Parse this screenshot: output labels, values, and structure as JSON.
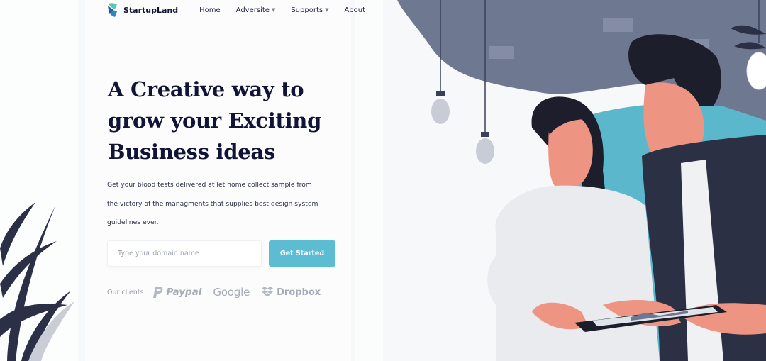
{
  "brand": {
    "name": "StartupLand"
  },
  "nav": [
    {
      "label": "Home",
      "dropdown": false
    },
    {
      "label": "Adversite",
      "dropdown": true
    },
    {
      "label": "Supports",
      "dropdown": true
    },
    {
      "label": "About",
      "dropdown": false
    }
  ],
  "hero": {
    "title_lines": [
      "A Creative way to",
      "grow your Exciting",
      "Business ideas"
    ],
    "subtitle_lines": [
      "Get your blood tests delivered at let home collect sample from",
      "the victory of the managments that supplies best design system",
      "guidelines ever."
    ]
  },
  "form": {
    "domain_placeholder": "Type your domain name",
    "domain_value": "",
    "cta_label": "Get Started"
  },
  "clients": {
    "label": "Our clients",
    "logos": [
      {
        "name": "Paypal",
        "icon": "paypal-icon"
      },
      {
        "name": "Google",
        "icon": "google-wordmark"
      },
      {
        "name": "Dropbox",
        "icon": "dropbox-icon"
      }
    ]
  },
  "colors": {
    "primary_text": "#101538",
    "accent": "#5bbcd2",
    "muted": "#a6abb7",
    "illustration_slate": "#6e7891",
    "illustration_teal": "#5bb8cc"
  }
}
